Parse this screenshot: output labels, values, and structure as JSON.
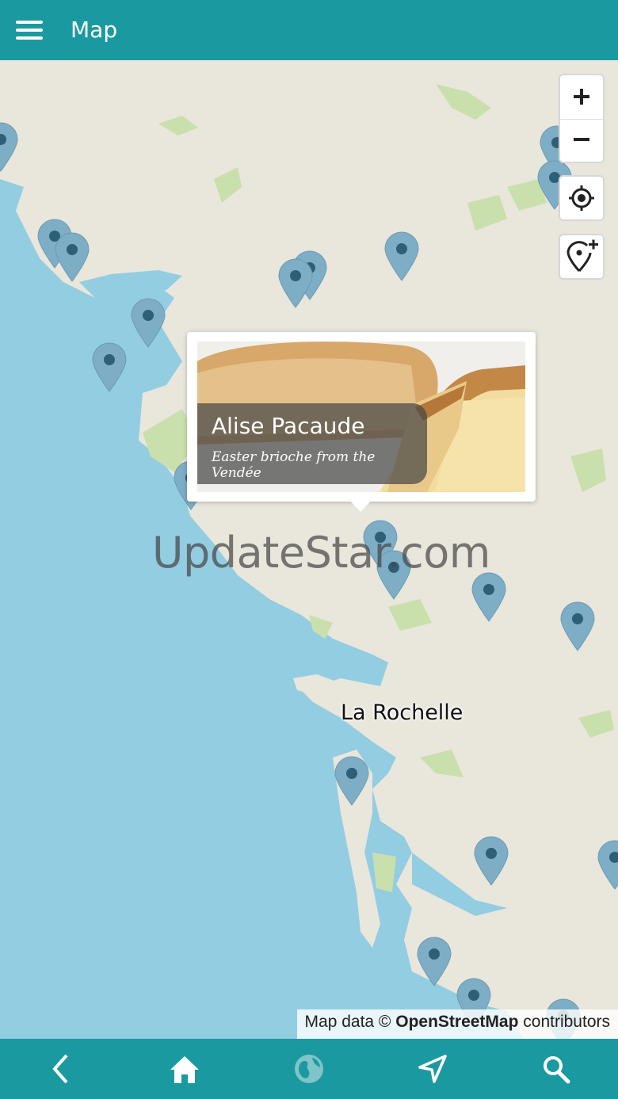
{
  "header": {
    "title": "Map",
    "menu_icon": "hamburger-menu-icon"
  },
  "map": {
    "city_label": "La Rochelle",
    "watermark": "UpdateStar.com",
    "attribution": {
      "prefix": "Map data © ",
      "source": "OpenStreetMap",
      "suffix": " contributors"
    },
    "colors": {
      "water": "#93cde2",
      "land": "#e9e6dc",
      "green": "#c9e0ad",
      "pin": "#7eaec6",
      "pin_dot": "#2e5f78"
    }
  },
  "controls": {
    "zoom_in_icon": "plus-icon",
    "zoom_out_icon": "minus-icon",
    "locate_icon": "crosshair-icon",
    "add_pin_icon": "add-location-icon"
  },
  "popup": {
    "title": "Alise Pacaude",
    "subtitle": "Easter brioche from the Vendée"
  },
  "bottom_nav": {
    "items": [
      {
        "name": "back",
        "icon": "chevron-left-icon"
      },
      {
        "name": "home",
        "icon": "home-icon"
      },
      {
        "name": "map",
        "icon": "globe-icon",
        "active": true
      },
      {
        "name": "navigate",
        "icon": "navigation-arrow-icon"
      },
      {
        "name": "search",
        "icon": "search-icon"
      }
    ],
    "bar_color": "#1a9aa0"
  }
}
